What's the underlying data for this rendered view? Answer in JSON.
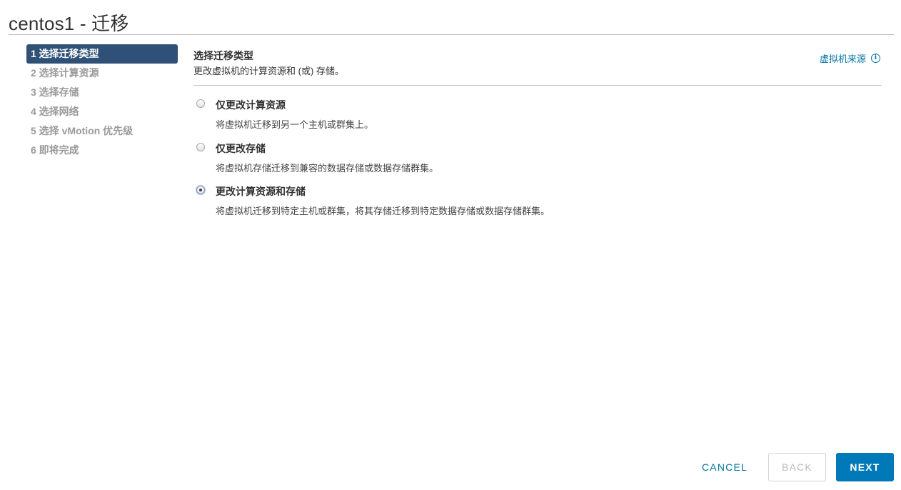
{
  "window": {
    "title": "centos1 - 迁移"
  },
  "steps": [
    {
      "label": "1 选择迁移类型",
      "active": true
    },
    {
      "label": "2 选择计算资源",
      "active": false
    },
    {
      "label": "3 选择存储",
      "active": false
    },
    {
      "label": "4 选择网络",
      "active": false
    },
    {
      "label": "5 选择 vMotion 优先级",
      "active": false
    },
    {
      "label": "6 即将完成",
      "active": false
    }
  ],
  "main": {
    "title": "选择迁移类型",
    "subtitle": "更改虚拟机的计算资源和 (或) 存储。",
    "source_link": "虚拟机来源",
    "source_icon": "info-icon"
  },
  "options": [
    {
      "label": "仅更改计算资源",
      "description": "将虚拟机迁移到另一个主机或群集上。",
      "checked": false
    },
    {
      "label": "仅更改存储",
      "description": "将虚拟机存储迁移到兼容的数据存储或数据存储群集。",
      "checked": false
    },
    {
      "label": "更改计算资源和存储",
      "description": "将虚拟机迁移到特定主机或群集，将其存储迁移到特定数据存储或数据存储群集。",
      "checked": true
    }
  ],
  "footer": {
    "cancel": "CANCEL",
    "back": "BACK",
    "next": "NEXT"
  },
  "colors": {
    "active_step_bg": "#2f5177",
    "link": "#0072a3",
    "primary_button": "#0079b8"
  }
}
